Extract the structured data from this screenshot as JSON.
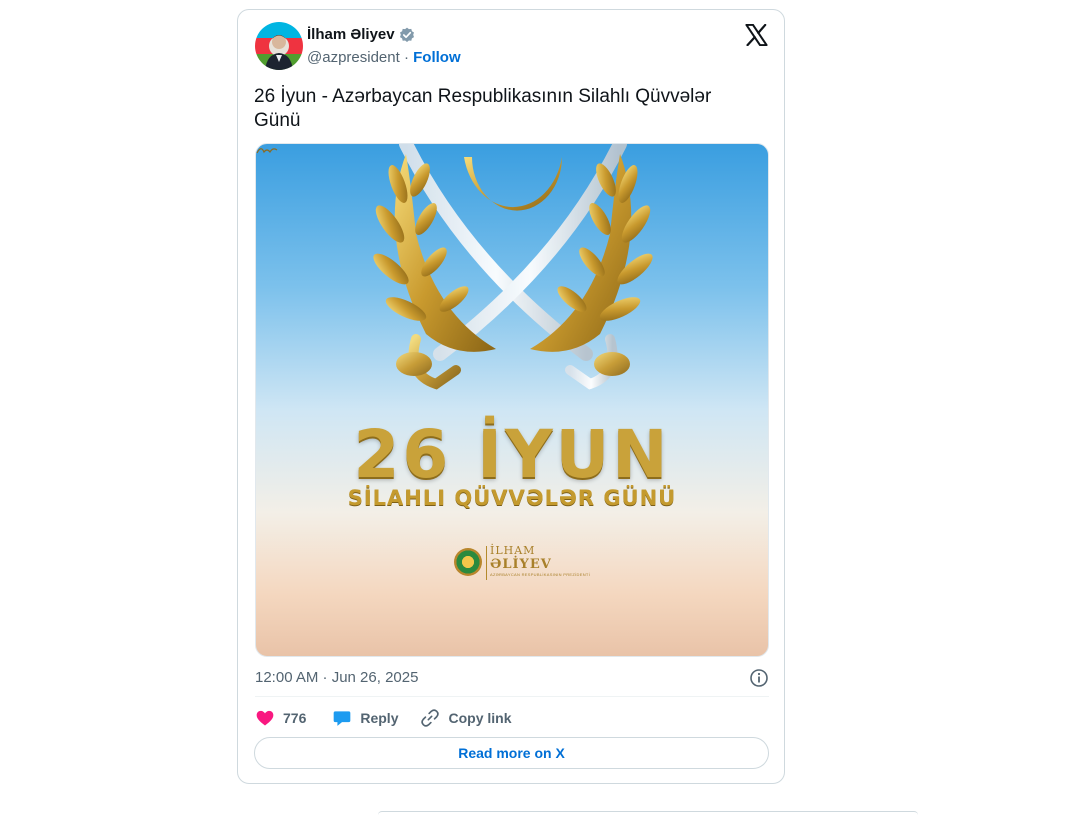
{
  "author": {
    "name": "İlham Əliyev",
    "handle": "@azpresident",
    "separator": "·",
    "follow_label": "Follow"
  },
  "tweet": {
    "text": "26 İyun - Azərbaycan Respublikasının Silahlı Qüvvələr Günü",
    "timestamp": "12:00 AM · Jun 26, 2025"
  },
  "media": {
    "headline": "26 İYUN",
    "subheadline": "SİLAHLI QÜVVƏLƏR GÜNÜ",
    "sig_first": "İLHAM",
    "sig_last": "ƏLİYEV",
    "sig_caption": "AZƏRBAYCAN RESPUBLİKASININ PREZİDENTİ"
  },
  "actions": {
    "likes_count": "776",
    "reply_label": "Reply",
    "copy_link_label": "Copy link"
  },
  "read_more_label": "Read more on X",
  "colors": {
    "link_blue": "#006fd6",
    "heart_pink": "#f91880",
    "reply_blue": "#1d9bf0",
    "verified_gray": "#829aab",
    "gold": "#c9a23a"
  },
  "icons": [
    "x-logo-icon",
    "verified-badge-icon",
    "info-icon",
    "heart-icon",
    "reply-bubble-icon",
    "link-icon"
  ]
}
